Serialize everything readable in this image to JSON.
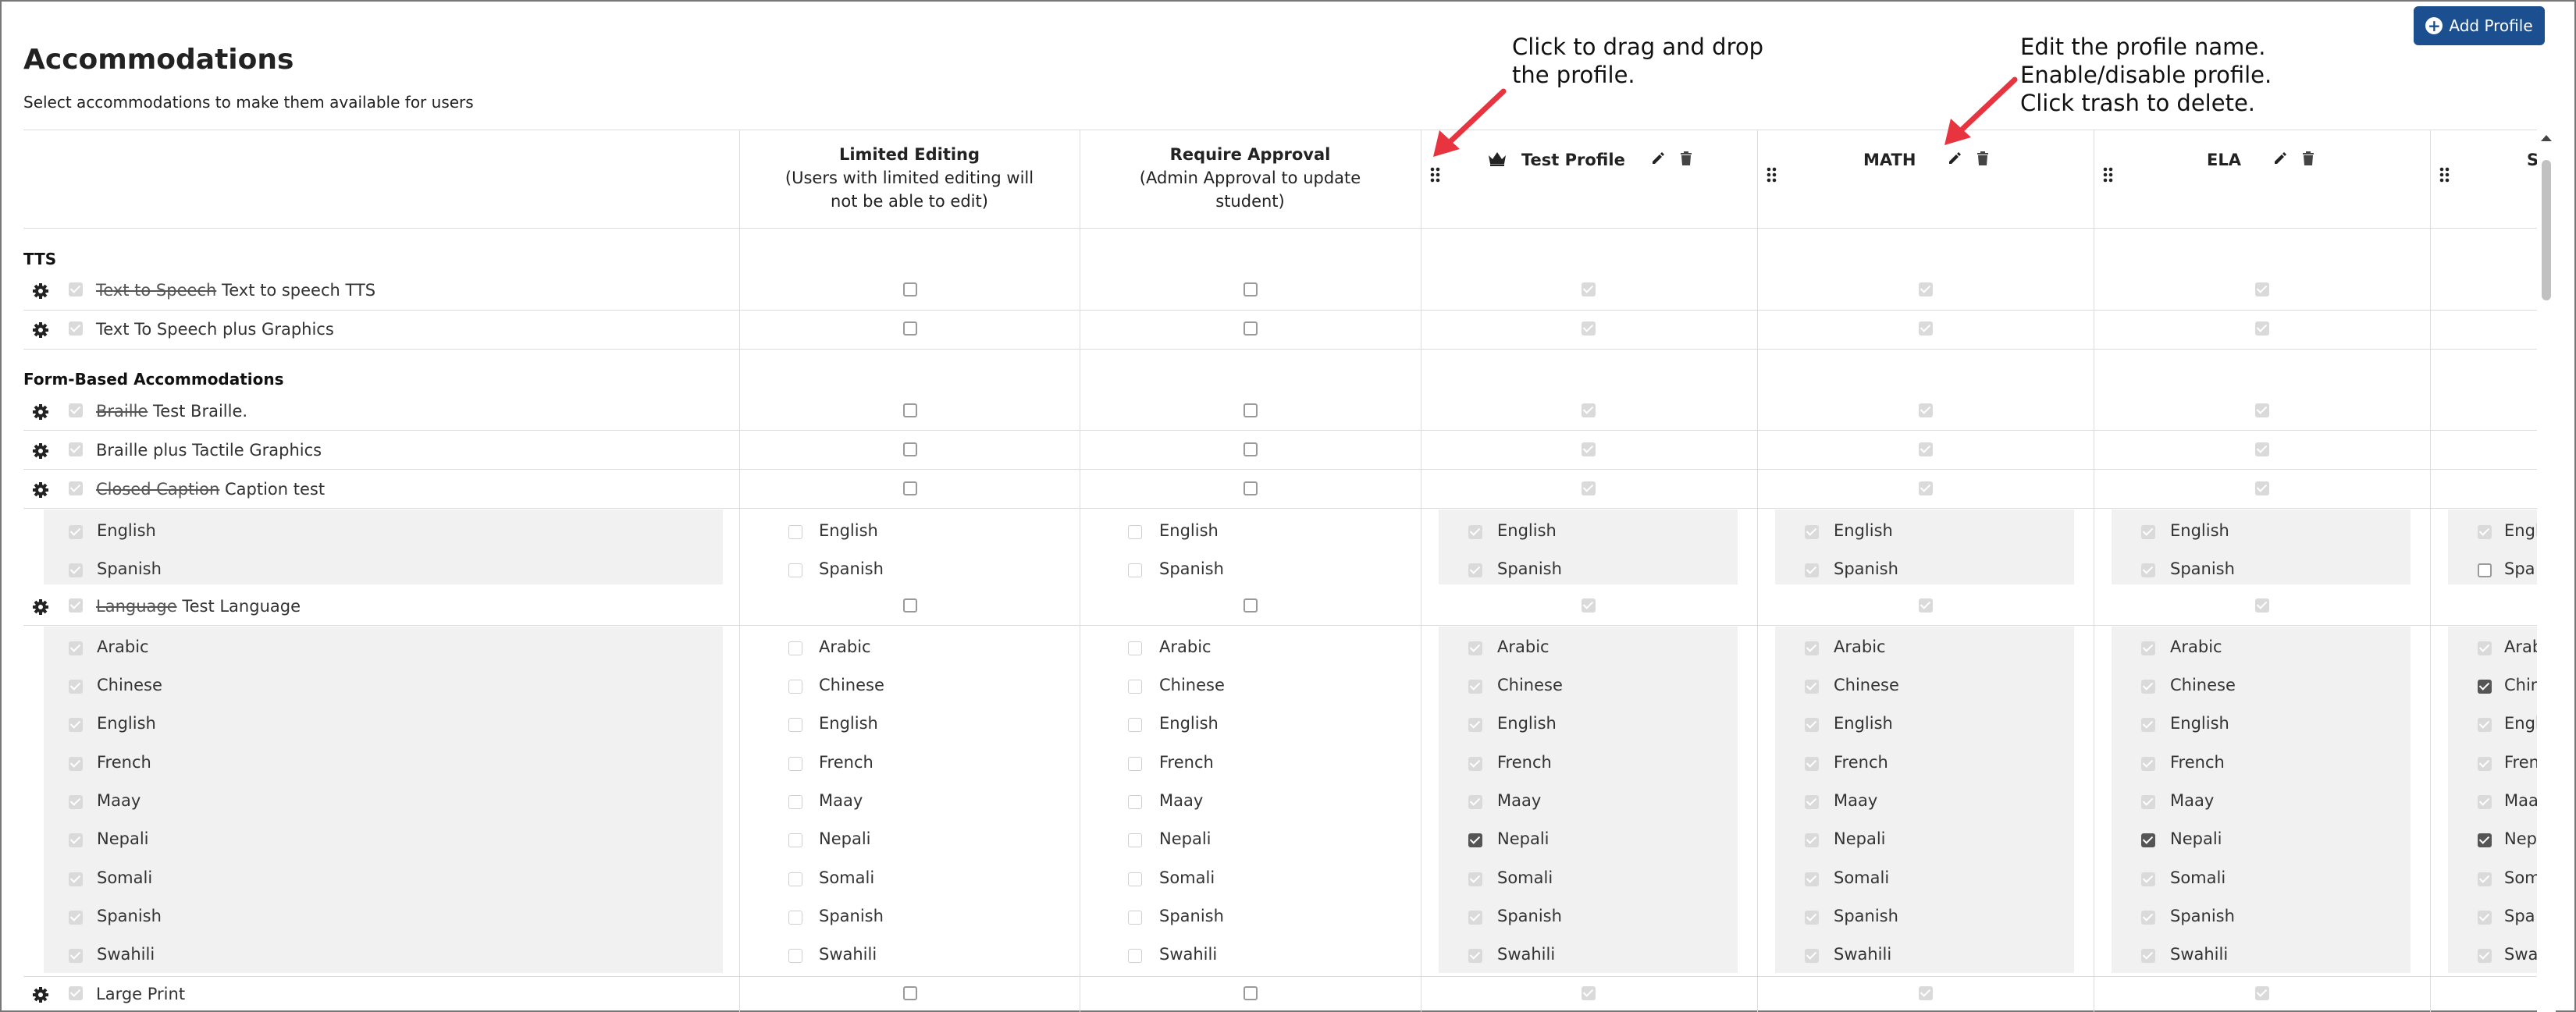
{
  "page": {
    "title": "Accommodations",
    "subtitle": "Select accommodations to make them available for users",
    "add_button": "Add Profile"
  },
  "columns": {
    "limited_editing": {
      "title": "Limited Editing",
      "line1": "(Users with limited editing will",
      "line2": "not be able to edit)"
    },
    "require_approval": {
      "title": "Require Approval",
      "line1": "(Admin Approval to update",
      "line2": "student)"
    }
  },
  "profiles": [
    {
      "name": "Test Profile",
      "default_crown": true
    },
    {
      "name": "MATH",
      "default_crown": false
    },
    {
      "name": "ELA",
      "default_crown": false
    },
    {
      "name": "S",
      "default_crown": false
    }
  ],
  "callouts": {
    "drag": {
      "line1": "Click to drag and drop",
      "line2": "the profile."
    },
    "edit": {
      "line1": "Edit the profile name.",
      "line2": "Enable/disable profile.",
      "line3": "Click trash to delete."
    }
  },
  "sections": {
    "tts": "TTS",
    "form": "Form-Based Accommodations"
  },
  "rows": {
    "tts1": {
      "old": "Text to Speech",
      "new": "Text to speech TTS"
    },
    "tts2": {
      "label": "Text To Speech plus Graphics"
    },
    "braille": {
      "old": "Braille",
      "new": "Test Braille."
    },
    "braille_tactile": {
      "label": "Braille plus Tactile Graphics"
    },
    "cc": {
      "old": "Closed Caption",
      "new": "Caption test"
    },
    "language": {
      "old": "Language",
      "new": "Test Language"
    },
    "large_print": {
      "label": "Large Print"
    }
  },
  "caption_options": [
    "English",
    "Spanish"
  ],
  "language_options": [
    "Arabic",
    "Chinese",
    "English",
    "French",
    "Maay",
    "Nepali",
    "Somali",
    "Spanish",
    "Swahili"
  ],
  "partial_last_column": {
    "caption": [
      "Engl",
      "Spa"
    ],
    "language": [
      "Arab",
      "Chin",
      "Engl",
      "Fren",
      "Maa",
      "Nep",
      "Som",
      "Spa",
      "Swa"
    ]
  },
  "icons": {
    "crown": "crown-icon",
    "edit": "pencil-icon",
    "delete": "trash-icon",
    "drag": "drag-handle-icon",
    "settings": "gear-icon",
    "add": "plus-circle-icon"
  },
  "colors": {
    "primary": "#1b4f8f",
    "arrow": "#e8343f"
  }
}
